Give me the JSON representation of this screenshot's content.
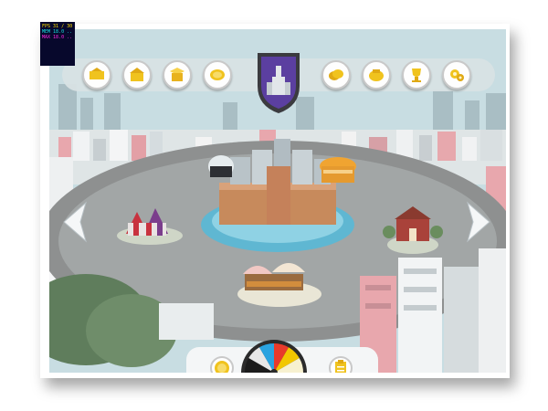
{
  "debug_overlay": {
    "lines": [
      "FPS 31 / 30",
      "MEM 18.0 ...",
      "MAX 18.0 ..."
    ],
    "colors": [
      "#ffe000",
      "#18e0e0",
      "#ff2be0"
    ]
  },
  "toolbar": {
    "left_icons": [
      "trade-icon",
      "bank-icon",
      "collection-icon",
      "coin-exchange-icon"
    ],
    "right_icons": [
      "coins-icon",
      "rewards-icon",
      "trophy-icon",
      "settings-gears-icon"
    ],
    "emblem_icon": "city-crest-icon"
  },
  "nav": {
    "left_icon": "arrow-left-icon",
    "right_icon": "arrow-right-icon"
  },
  "bottom_bar": {
    "left_icon": "coin-icon",
    "center_icon": "spin-wheel-icon",
    "right_icon": "quests-clipboard-icon",
    "wheel_colors": [
      "#1c1c1c",
      "#e8e8e8",
      "#2aa3e0",
      "#e83a2b",
      "#f2c700",
      "#f7f1d0"
    ]
  },
  "buildings": [
    "circus-tent",
    "city-hall-fortress",
    "observatory-dome",
    "theater-building",
    "school-building",
    "fruit-market-stalls"
  ],
  "colors": {
    "sky": "#c8dde2",
    "road": "#8c8e8e",
    "plaza": "#9ea3a3",
    "gold": "#f0c31e",
    "crest": "#5b3fa0"
  }
}
